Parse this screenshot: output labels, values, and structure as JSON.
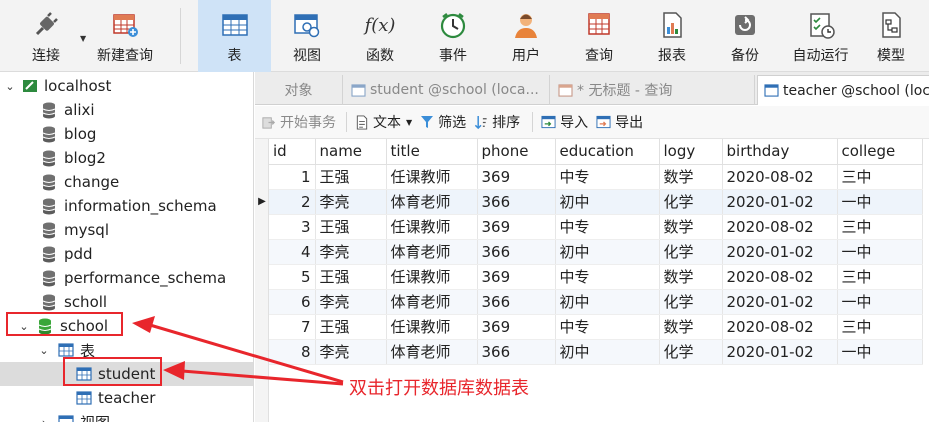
{
  "toolbar": {
    "items": [
      {
        "label": "连接",
        "icon": "plug-icon"
      },
      {
        "label": "新建查询",
        "icon": "new-query-icon"
      },
      {
        "label": "表",
        "icon": "table-icon"
      },
      {
        "label": "视图",
        "icon": "view-icon"
      },
      {
        "label": "函数",
        "icon": "function-icon"
      },
      {
        "label": "事件",
        "icon": "clock-icon"
      },
      {
        "label": "用户",
        "icon": "user-icon"
      },
      {
        "label": "查询",
        "icon": "query-icon"
      },
      {
        "label": "报表",
        "icon": "report-icon"
      },
      {
        "label": "备份",
        "icon": "backup-icon"
      },
      {
        "label": "自动运行",
        "icon": "autorun-icon"
      },
      {
        "label": "模型",
        "icon": "model-icon"
      }
    ],
    "function_glyph": "f(x)"
  },
  "sidebar": {
    "connection": "localhost",
    "databases": [
      "alixi",
      "blog",
      "blog2",
      "change",
      "information_schema",
      "mysql",
      "pdd",
      "performance_schema",
      "scholl"
    ],
    "selected_db": "school",
    "tables_label": "表",
    "tables": [
      "student",
      "teacher"
    ],
    "views_label": "视图"
  },
  "tabs": {
    "objects": "对象",
    "tab1": "student @school (loca...",
    "tab2": "* 无标题 - 查询",
    "tab3": "teacher @school (loc"
  },
  "subtoolbar": {
    "begin": "开始事务",
    "text": "文本",
    "filter": "筛选",
    "sort": "排序",
    "import": "导入",
    "export": "导出"
  },
  "grid": {
    "columns": [
      "id",
      "name",
      "title",
      "phone",
      "education",
      "logy",
      "birthday",
      "college"
    ],
    "rows": [
      [
        "1",
        "王强",
        "任课教师",
        "369",
        "中专",
        "数学",
        "2020-08-02",
        "三中"
      ],
      [
        "2",
        "李亮",
        "体育老师",
        "366",
        "初中",
        "化学",
        "2020-01-02",
        "一中"
      ],
      [
        "3",
        "王强",
        "任课教师",
        "369",
        "中专",
        "数学",
        "2020-08-02",
        "三中"
      ],
      [
        "4",
        "李亮",
        "体育老师",
        "366",
        "初中",
        "化学",
        "2020-01-02",
        "一中"
      ],
      [
        "5",
        "王强",
        "任课教师",
        "369",
        "中专",
        "数学",
        "2020-08-02",
        "三中"
      ],
      [
        "6",
        "李亮",
        "体育老师",
        "366",
        "初中",
        "化学",
        "2020-01-02",
        "一中"
      ],
      [
        "7",
        "王强",
        "任课教师",
        "369",
        "中专",
        "数学",
        "2020-08-02",
        "三中"
      ],
      [
        "8",
        "李亮",
        "体育老师",
        "366",
        "初中",
        "化学",
        "2020-01-02",
        "一中"
      ]
    ]
  },
  "annotation": {
    "text": "双击打开数据库数据表",
    "color": "#e8262c"
  },
  "colors": {
    "active_tool": "#cfe3f7",
    "db_icon": "#707070",
    "db_selected": "#3aa63a",
    "table_icon": "#2f6fb5"
  }
}
